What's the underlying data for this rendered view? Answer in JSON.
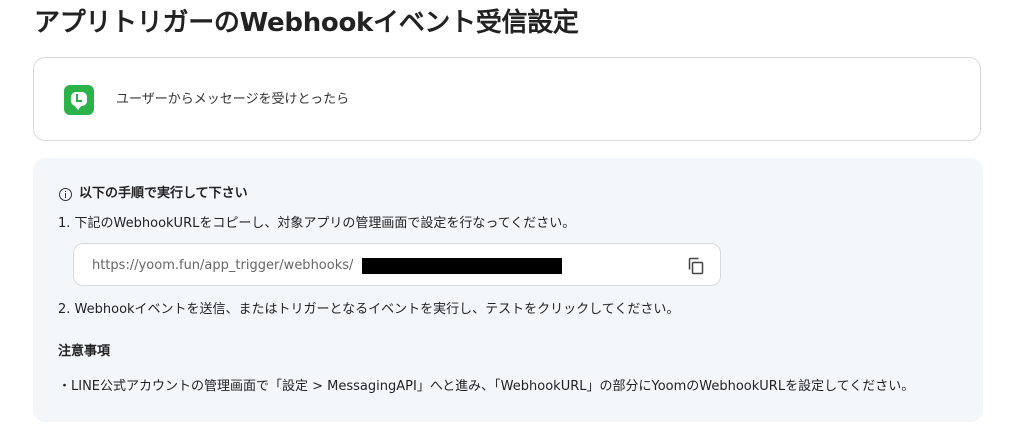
{
  "page": {
    "title": "アプリトリガーのWebhookイベント受信設定"
  },
  "trigger": {
    "icon": "line-app-icon",
    "label": "ユーザーからメッセージを受けとったら",
    "icon_color": "#2bb34a"
  },
  "instructions": {
    "heading_icon": "info-icon",
    "heading": "以下の手順で実行して下さい",
    "step1": "1. 下記のWebhookURLをコピーし、対象アプリの管理画面で設定を行なってください。",
    "webhook_url": "https://yoom.fun/app_trigger/webhooks/",
    "copy_icon": "copy-icon",
    "step2": "2. Webhookイベントを送信、またはトリガーとなるイベントを実行し、テストをクリックしてください。",
    "notes_heading": "注意事項",
    "notes_text": "・LINE公式アカウントの管理画面で「設定 > MessagingAPI」へと進み、「WebhookURL」の部分にYoomのWebhookURLを設定してください。"
  },
  "colors": {
    "panel_background": "#f4f7fa",
    "border": "#d6d9de"
  }
}
